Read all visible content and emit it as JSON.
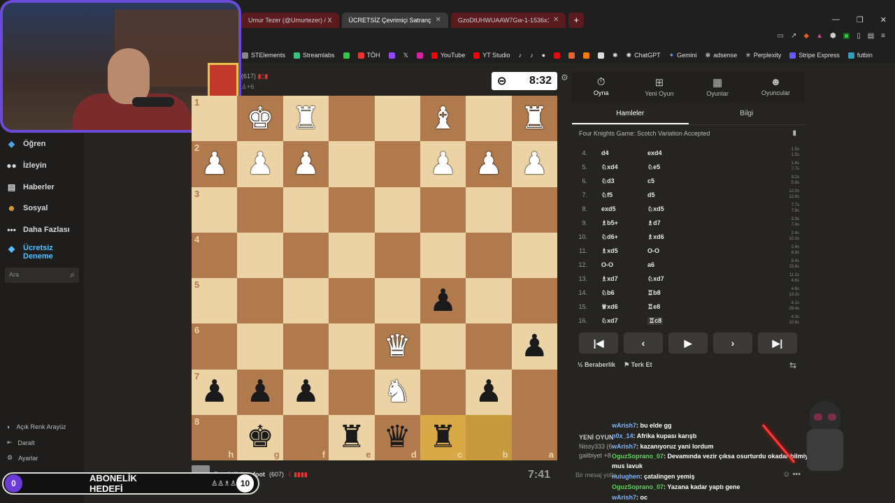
{
  "browser": {
    "tabs": [
      {
        "title": "Umur Tezer (@Umurtezer) / X"
      },
      {
        "title": "ÜCRETSİZ Çevrimiçi Satranç Oyna"
      },
      {
        "title": "GzoDtUHWUAAW7Gw-1-1536x1536"
      }
    ],
    "bookmarks": [
      "STElements",
      "Streamlabs",
      "TÖH",
      "YouTube",
      "YT Studio",
      "ChatGPT",
      "Gemini",
      "adsense",
      "Perplexity",
      "Stripe Express",
      "futbin"
    ]
  },
  "sidebar": {
    "items": [
      {
        "label": "Öğren",
        "icon": "graduation-cap-icon"
      },
      {
        "label": "İzleyin",
        "icon": "binoculars-icon"
      },
      {
        "label": "Haberler",
        "icon": "news-icon"
      },
      {
        "label": "Sosyal",
        "icon": "people-icon"
      },
      {
        "label": "Daha Fazlası",
        "icon": "more-dots-icon"
      },
      {
        "label": "Ücretsiz Deneme",
        "icon": "diamond-icon"
      }
    ],
    "search_placeholder": "Ara",
    "footer": [
      {
        "label": "Açık Renk Arayüz"
      },
      {
        "label": "Daralt"
      },
      {
        "label": "Ayarlar"
      }
    ]
  },
  "game": {
    "top_player": {
      "rating": "(617)",
      "diff": "+6",
      "clock": "8:32"
    },
    "bottom_player": {
      "name": "BundolinIronfoot",
      "rating": "(607)",
      "clock": "7:41"
    },
    "files": [
      "h",
      "g",
      "f",
      "e",
      "d",
      "c",
      "b",
      "a"
    ],
    "ranks": [
      "1",
      "2",
      "3",
      "4",
      "5",
      "6",
      "7",
      "8"
    ]
  },
  "panel": {
    "tabs": [
      "Oyna",
      "Yeni Oyun",
      "Oyunlar",
      "Oyuncular"
    ],
    "sub_tabs": [
      "Hamleler",
      "Bilgi"
    ],
    "opening": "Four Knights Game: Scotch Variation Accepted",
    "moves": [
      {
        "n": "4.",
        "w": "d4",
        "b": "exd4",
        "tw": "1.5s",
        "tb": "1.5s"
      },
      {
        "n": "5.",
        "w": "♘xd4",
        "b": "♘e5",
        "tw": "1.6s",
        "tb": "7.7s"
      },
      {
        "n": "6.",
        "w": "♘d3",
        "b": "c5",
        "tw": "9.2s",
        "tb": "5.9s"
      },
      {
        "n": "7.",
        "w": "♘f5",
        "b": "d5",
        "tw": "12.0s",
        "tb": "12.8s"
      },
      {
        "n": "8.",
        "w": "exd5",
        "b": "♘xd5",
        "tw": "7.7s",
        "tb": "7.8s"
      },
      {
        "n": "9.",
        "w": "♗b5+",
        "b": "♗d7",
        "tw": "3.3s",
        "tb": "7.4s"
      },
      {
        "n": "10.",
        "w": "♘d6+",
        "b": "♗xd6",
        "tw": "2.4s",
        "tb": "10.3s"
      },
      {
        "n": "11.",
        "w": "♗xd5",
        "b": "O-O",
        "tw": "2.4s",
        "tb": "8.9s"
      },
      {
        "n": "12.",
        "w": "O-O",
        "b": "a6",
        "tw": "8.4s",
        "tb": "15.8s"
      },
      {
        "n": "13.",
        "w": "♗xd7",
        "b": "♘xd7",
        "tw": "11.1s",
        "tb": "4.6s"
      },
      {
        "n": "14.",
        "w": "♘b6",
        "b": "♖b8",
        "tw": "4.6s",
        "tb": "13.3s"
      },
      {
        "n": "15.",
        "w": "♕xd6",
        "b": "♖e8",
        "tw": "4.1s",
        "tb": "28.4s"
      },
      {
        "n": "16.",
        "w": "♘xd7",
        "b": "♖c8",
        "tw": "4.3s",
        "tb": "10.8s"
      }
    ],
    "draw": "Beraberlik",
    "resign": "Terk Et"
  },
  "chat": {
    "lines": [
      {
        "user": "wArish7",
        "msg": ": bu elde gg",
        "color": "blue"
      },
      {
        "user": "n0x_14",
        "msg": ": Afrika kupası karıştı",
        "color": "blue"
      },
      {
        "user": "wArish7",
        "msg": ": kazanıyoruz yani lordum",
        "color": "blue"
      },
      {
        "user": "OguzSoprano_07",
        "msg": ": Devamında vezir çıksa osurturdu okadar bilmiyor",
        "color": "green"
      },
      {
        "user": "",
        "msg": "mus lavuk",
        "color": "none"
      },
      {
        "user": "nulughen",
        "msg": ": çatalingen yemiş",
        "color": "blue"
      },
      {
        "user": "OguzSoprano_07",
        "msg": ": Yazana kadar yaptı gene",
        "color": "green"
      },
      {
        "user": "wArish7",
        "msg": ": oc",
        "color": "blue"
      }
    ],
    "ghost": {
      "title": "YENİ OYUN",
      "line1": "Nissy333 (6",
      "line2": "galibiyet +8"
    },
    "input_placeholder": "Bir mesaj yolla"
  },
  "overlay": {
    "sub_goal_label": "ABONELİK HEDEFİ",
    "current": "0",
    "target": "10"
  }
}
